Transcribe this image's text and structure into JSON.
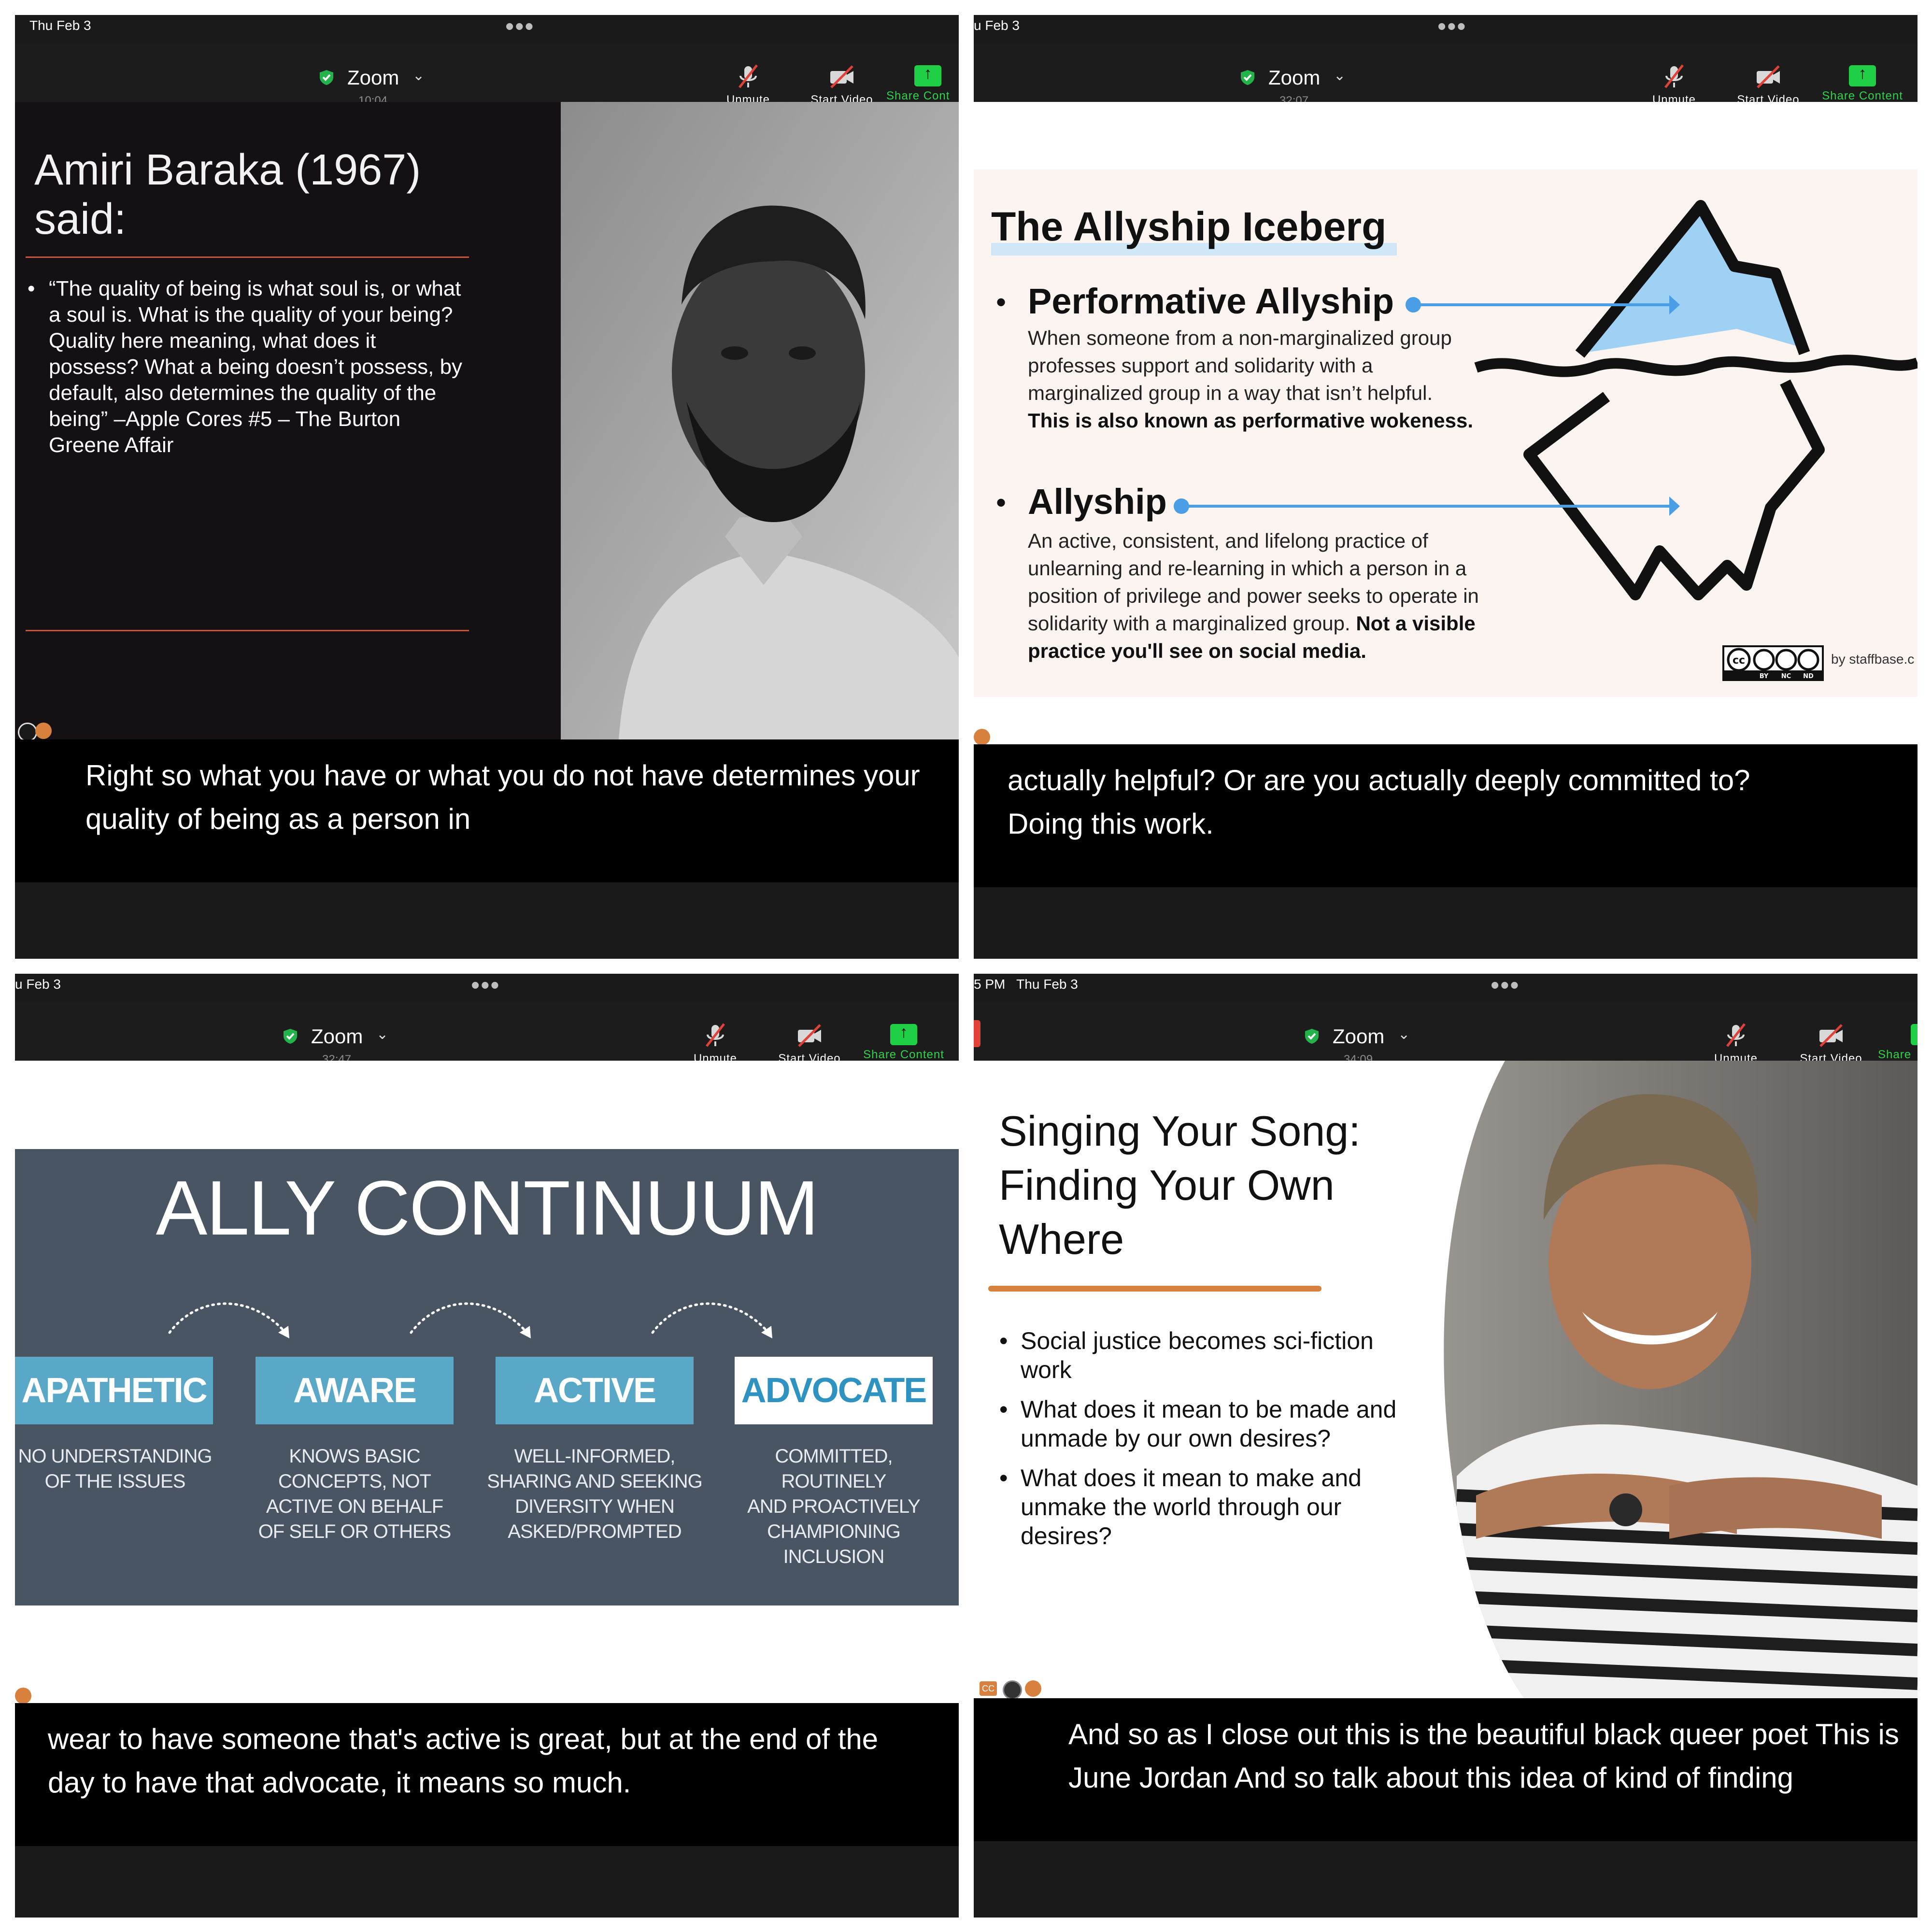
{
  "colors": {
    "share_green": "#1fd046",
    "mute_red": "#e0423a",
    "slide1_rule": "#c8543a",
    "iceberg_blue": "#9fd1f4",
    "arrow_blue": "#4a9ee6",
    "continuum_bg": "#4a5563",
    "continuum_box": "#5aa8c8",
    "slide4_rule": "#d8813e"
  },
  "toolbar": {
    "app_name": "Zoom",
    "unmute": "Unmute",
    "start_video": "Start Video",
    "share_content": "Share Content",
    "more_icon": "ellipsis-icon",
    "shield_icon": "shield-check-icon"
  },
  "panels": [
    {
      "status_time": "Thu Feb 3",
      "timer": "10:04",
      "share_label": "Share Cont",
      "caption": [
        "Right so what you have or what you do not have determines your",
        "quality of being as a person in"
      ],
      "slide": {
        "title_lines": [
          "Amiri Baraka (1967)",
          "said:"
        ],
        "quote": "“The  quality of being is what soul is, or what a soul is. What is the quality of your being? Quality here meaning, what does it possess? What a being doesn’t possess, by default, also determines the quality of the being” –Apple Cores #5 – The Burton Greene Affair",
        "photo": "portrait-photo"
      }
    },
    {
      "status_time": "u Feb 3",
      "timer": "32:07",
      "share_label": "Share Content",
      "caption": [
        "actually helpful? Or are you actually deeply committed to?",
        "Doing this work."
      ],
      "slide": {
        "title": "The Allyship Iceberg",
        "items": [
          {
            "label": "Performative Allyship",
            "desc_lines": [
              "When someone from a non-marginalized group",
              "professes support and solidarity with a",
              "marginalized group in a way that isn’t helpful."
            ],
            "desc_bold": "This is also known as performative wokeness."
          },
          {
            "label": "Allyship",
            "desc_lines": [
              "An active, consistent, and lifelong practice of",
              "unlearning and re-learning in which a person in a",
              "position of privilege and power seeks to operate in"
            ],
            "desc_mixed_plain": "solidarity with a marginalized group. ",
            "desc_mixed_bold": "Not a visible",
            "desc_bold": "practice you'll see on social media."
          }
        ],
        "license_icon": "cc-by-nc-nd-icon",
        "license_sub": [
          "BY",
          "NC",
          "ND"
        ],
        "credit": "by staffbase.c"
      }
    },
    {
      "status_time": "u Feb 3",
      "timer": "32:47",
      "share_label": "Share Content",
      "caption": [
        "wear to have someone that's active is great, but at the end of the",
        "day to have that advocate, it means so much."
      ],
      "slide": {
        "title": "ALLY CONTINUUM",
        "stages": [
          {
            "label": "APATHETIC",
            "desc": [
              "NO UNDERSTANDING",
              "OF THE ISSUES"
            ]
          },
          {
            "label": "AWARE",
            "desc": [
              "KNOWS BASIC",
              "CONCEPTS, NOT",
              "ACTIVE ON BEHALF",
              "OF SELF OR OTHERS"
            ]
          },
          {
            "label": "ACTIVE",
            "desc": [
              "WELL-INFORMED,",
              "SHARING AND SEEKING",
              "DIVERSITY WHEN",
              "ASKED/PROMPTED"
            ]
          },
          {
            "label": "ADVOCATE",
            "desc": [
              "COMMITTED, ROUTINELY",
              "AND PROACTIVELY",
              "CHAMPIONING",
              "INCLUSION"
            ]
          }
        ]
      }
    },
    {
      "status_time": "5 PM   Thu Feb 3",
      "timer": "34:09",
      "share_label": "Share",
      "caption": [
        "And so as I close out this is the beautiful black queer poet This is",
        "June Jordan And so talk about this idea of kind of finding"
      ],
      "slide": {
        "title_lines": [
          "Singing Your Song:",
          "Finding Your Own",
          "Where"
        ],
        "bullets": [
          "Social justice becomes sci-fiction work",
          "What does it mean to be made and unmade by our own desires?",
          "What does it mean to make and unmake the world through our desires?"
        ],
        "photo": "portrait-photo",
        "cc_badge": "CC"
      }
    }
  ]
}
